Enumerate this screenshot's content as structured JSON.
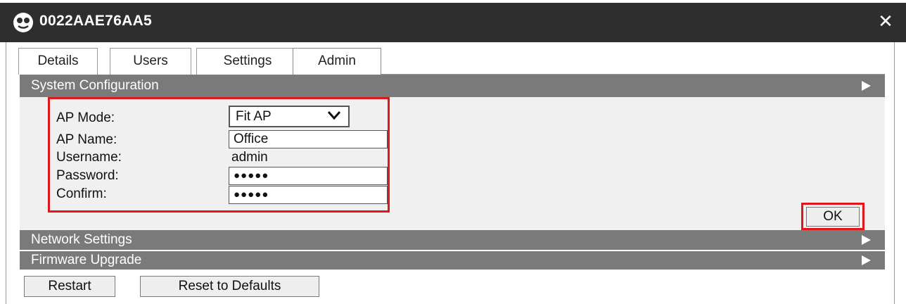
{
  "window": {
    "title": "0022AAE76AA5",
    "logo_icon": "wireless-ap-logo-icon",
    "close_icon": "close-icon"
  },
  "tabs": [
    {
      "label": "Details",
      "active": false
    },
    {
      "label": "Users",
      "active": false
    },
    {
      "label": "Settings",
      "active": false
    },
    {
      "label": "Admin",
      "active": true
    }
  ],
  "sections": {
    "system_configuration": {
      "label": "System Configuration",
      "expanded": true
    },
    "network_settings": {
      "label": "Network Settings",
      "expanded": false
    },
    "firmware_upgrade": {
      "label": "Firmware Upgrade",
      "expanded": false
    }
  },
  "form": {
    "ap_mode": {
      "label": "AP Mode:",
      "value": "Fit AP"
    },
    "ap_name": {
      "label": "AP Name:",
      "value": "Office"
    },
    "username": {
      "label": "Username:",
      "value": "admin"
    },
    "password": {
      "label": "Password:",
      "value": "●●●●●"
    },
    "confirm": {
      "label": "Confirm:",
      "value": "●●●●●"
    },
    "ok_label": "OK"
  },
  "footer": {
    "restart_label": "Restart",
    "reset_label": "Reset to Defaults"
  },
  "colors": {
    "titlebar": "#2e2e2e",
    "section_header": "#7a7a7a",
    "highlight": "#e0161b"
  }
}
